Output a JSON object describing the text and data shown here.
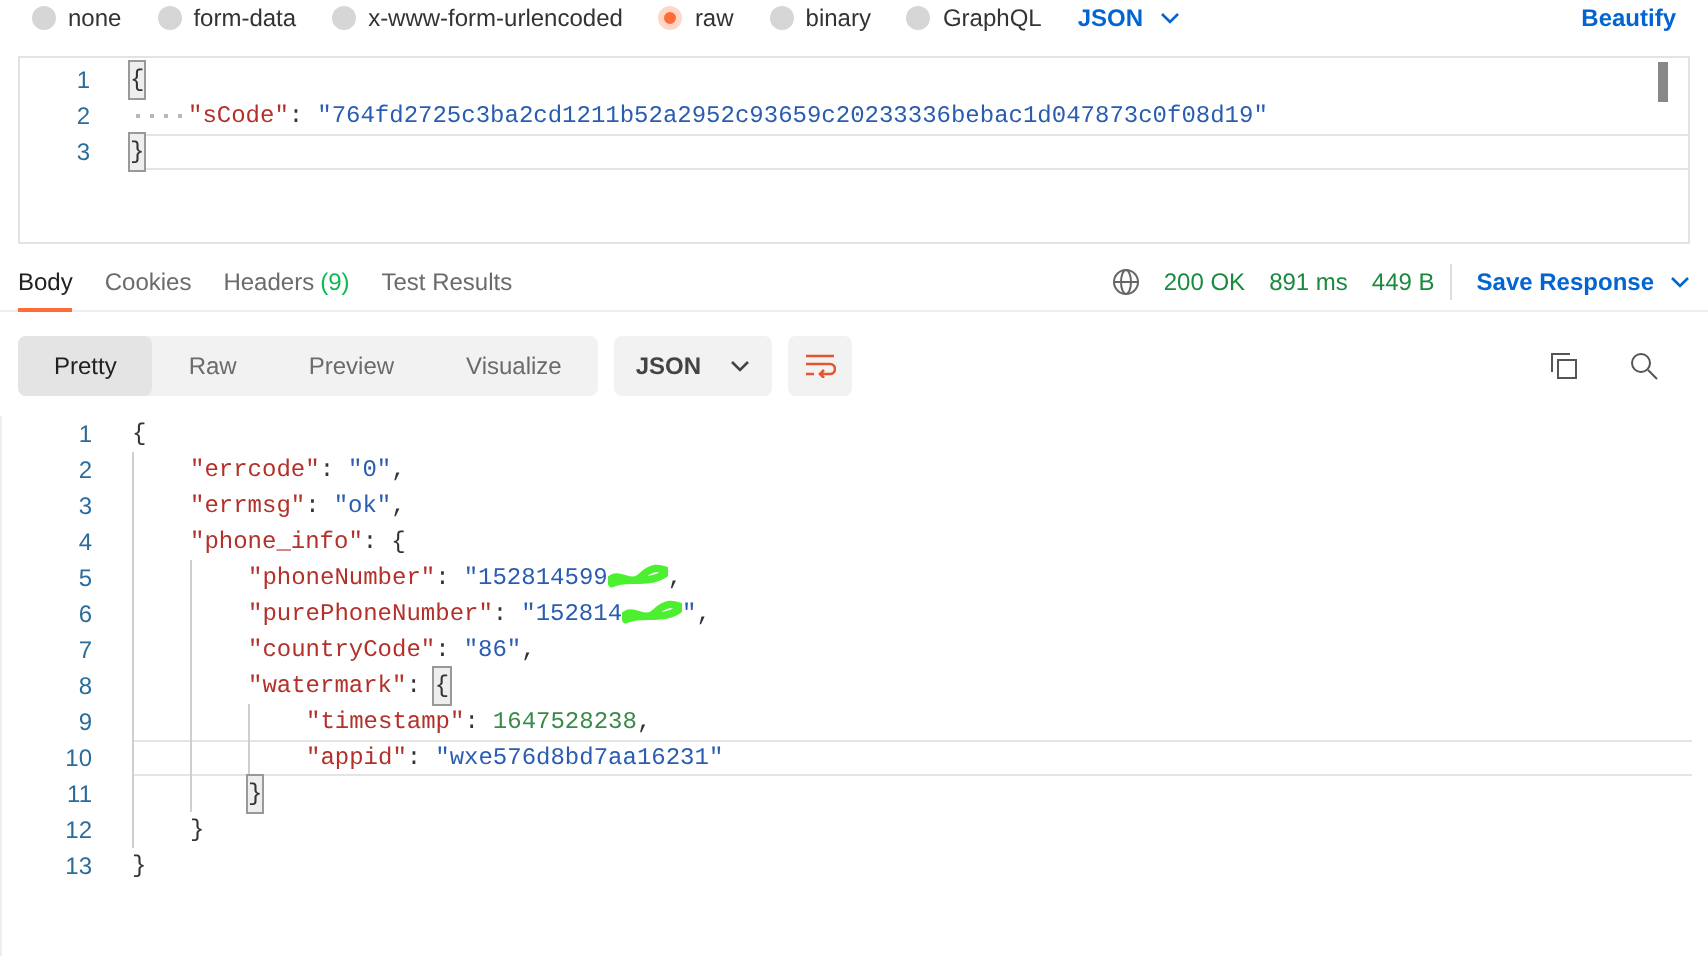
{
  "body_types": [
    {
      "label": "none",
      "selected": false
    },
    {
      "label": "form-data",
      "selected": false
    },
    {
      "label": "x-www-form-urlencoded",
      "selected": false
    },
    {
      "label": "raw",
      "selected": true
    },
    {
      "label": "binary",
      "selected": false
    },
    {
      "label": "GraphQL",
      "selected": false
    }
  ],
  "format_dropdown": "JSON",
  "beautify": "Beautify",
  "request_editor": {
    "lines": [
      {
        "number": "1",
        "current": false,
        "tokens": [
          {
            "kind": "brace",
            "text": "{"
          }
        ],
        "children": [
          {
            "number": "2",
            "current": false,
            "tokens": [
              {
                "kind": "key",
                "text": "\"sCode\""
              },
              {
                "kind": "punct",
                "text": ":"
              },
              {
                "kind": "string",
                "text": "\"764fd2725c3ba2cd1211b52a2952c93659c20233336bebac1d047873c0f08d19\""
              }
            ]
          }
        ]
      },
      {
        "number": "3",
        "current": true,
        "tokens": [
          {
            "kind": "brace",
            "text": "}"
          }
        ]
      }
    ]
  },
  "response_tabs": [
    {
      "label": "Body",
      "selected": true
    },
    {
      "label": "Cookies",
      "selected": false
    },
    {
      "label": "Headers",
      "count": "(9)",
      "selected": false
    },
    {
      "label": "Test Results",
      "selected": false
    }
  ],
  "status": {
    "code": "200 OK",
    "time": "891 ms",
    "size": "449 B"
  },
  "save_response": "Save Response",
  "view_tabs": [
    {
      "label": "Pretty",
      "selected": true
    },
    {
      "label": "Raw",
      "selected": false
    },
    {
      "label": "Preview",
      "selected": false
    },
    {
      "label": "Visualize",
      "selected": false
    }
  ],
  "response_format": "JSON",
  "response_editor": {
    "lines": [
      {
        "number": "1",
        "current": false,
        "tokens": [
          {
            "kind": "punct",
            "text": "{"
          }
        ],
        "children": [
          {
            "number": "2",
            "current": false,
            "tokens": [
              {
                "kind": "key",
                "text": "\"errcode\""
              },
              {
                "kind": "punct",
                "text": ":"
              },
              {
                "kind": "string",
                "text": "\"0\""
              },
              {
                "kind": "punct",
                "text": ","
              }
            ]
          },
          {
            "number": "3",
            "current": false,
            "tokens": [
              {
                "kind": "key",
                "text": "\"errmsg\""
              },
              {
                "kind": "punct",
                "text": ":"
              },
              {
                "kind": "string",
                "text": "\"ok\""
              },
              {
                "kind": "punct",
                "text": ","
              }
            ]
          },
          {
            "number": "4",
            "current": false,
            "tokens": [
              {
                "kind": "key",
                "text": "\"phone_info\""
              },
              {
                "kind": "punct",
                "text": ":"
              },
              {
                "kind": "punct",
                "text": "{"
              }
            ],
            "children": [
              {
                "number": "5",
                "current": false,
                "tokens": [
                  {
                    "kind": "key",
                    "text": "\"phoneNumber\""
                  },
                  {
                    "kind": "punct",
                    "text": ":"
                  },
                  {
                    "kind": "string",
                    "text": "\"152814599"
                  },
                  {
                    "kind": "redaction"
                  },
                  {
                    "kind": "punct",
                    "text": ","
                  }
                ]
              },
              {
                "number": "6",
                "current": false,
                "tokens": [
                  {
                    "kind": "key",
                    "text": "\"purePhoneNumber\""
                  },
                  {
                    "kind": "punct",
                    "text": ":"
                  },
                  {
                    "kind": "string",
                    "text": "\"152814"
                  },
                  {
                    "kind": "redaction"
                  },
                  {
                    "kind": "string",
                    "text": "\""
                  },
                  {
                    "kind": "punct",
                    "text": ","
                  }
                ]
              },
              {
                "number": "7",
                "current": false,
                "tokens": [
                  {
                    "kind": "key",
                    "text": "\"countryCode\""
                  },
                  {
                    "kind": "punct",
                    "text": ":"
                  },
                  {
                    "kind": "string",
                    "text": "\"86\""
                  },
                  {
                    "kind": "punct",
                    "text": ","
                  }
                ]
              },
              {
                "number": "8",
                "current": false,
                "tokens": [
                  {
                    "kind": "key",
                    "text": "\"watermark\""
                  },
                  {
                    "kind": "punct",
                    "text": ":"
                  },
                  {
                    "kind": "brace",
                    "text": "{"
                  }
                ],
                "children": [
                  {
                    "number": "9",
                    "current": false,
                    "tokens": [
                      {
                        "kind": "key",
                        "text": "\"timestamp\""
                      },
                      {
                        "kind": "punct",
                        "text": ":"
                      },
                      {
                        "kind": "number",
                        "text": "1647528238"
                      },
                      {
                        "kind": "punct",
                        "text": ","
                      }
                    ]
                  },
                  {
                    "number": "10",
                    "current": true,
                    "tokens": [
                      {
                        "kind": "key",
                        "text": "\"appid\""
                      },
                      {
                        "kind": "punct",
                        "text": ":"
                      },
                      {
                        "kind": "string",
                        "text": "\"wxe576d8bd7aa16231\""
                      }
                    ]
                  }
                ]
              },
              {
                "number": "11",
                "current": false,
                "tokens": [
                  {
                    "kind": "brace",
                    "text": "}"
                  }
                ]
              }
            ]
          },
          {
            "number": "12",
            "current": false,
            "tokens": [
              {
                "kind": "punct",
                "text": "}"
              }
            ]
          }
        ]
      },
      {
        "number": "13",
        "current": false,
        "tokens": [
          {
            "kind": "punct",
            "text": "}"
          }
        ]
      }
    ]
  }
}
